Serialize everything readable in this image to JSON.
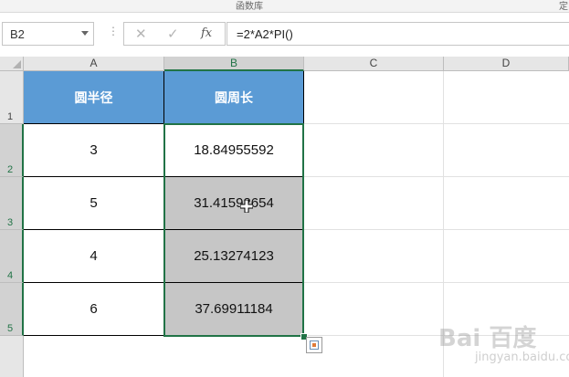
{
  "ribbon": {
    "group_label": "函数库",
    "corner_label": "定"
  },
  "formula_bar": {
    "name_box": "B2",
    "cancel_glyph": "✕",
    "enter_glyph": "✓",
    "insert_function_glyph": "fx",
    "formula": "=2*A2*PI()"
  },
  "columns": [
    "A",
    "B",
    "C",
    "D"
  ],
  "rows": [
    "1",
    "2",
    "3",
    "4",
    "5"
  ],
  "table": {
    "headers": [
      "圆半径",
      "圆周长"
    ],
    "rows": [
      [
        "3",
        "18.84955592"
      ],
      [
        "5",
        "31.41592654"
      ],
      [
        "4",
        "25.13274123"
      ],
      [
        "6",
        "37.69911184"
      ]
    ]
  },
  "watermark": {
    "brand": "Bai 百度",
    "sub": "jingyan.baidu.com"
  },
  "colors": {
    "header_fill": "#5b9bd5",
    "selection_border": "#217346",
    "selected_fill": "#c6c6c6"
  }
}
